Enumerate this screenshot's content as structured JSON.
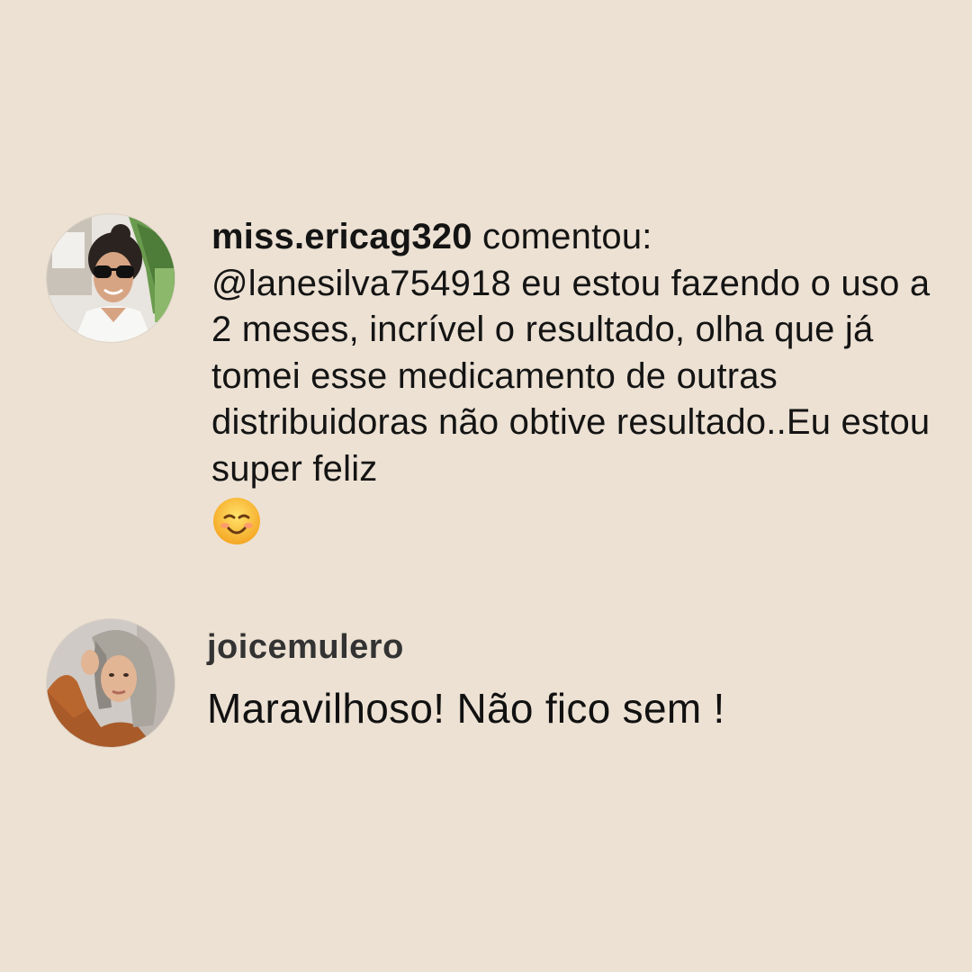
{
  "comments": [
    {
      "username": "miss.ericag320",
      "action": "comentou:",
      "text": "@lanesilva754918 eu estou fazendo o uso a 2 meses,  incrível o resultado, olha que já tomei esse medicamento de outras distribuidoras não obtive resultado..Eu estou super feliz",
      "emoji": "smiling-face-icon"
    },
    {
      "username": "joicemulero",
      "text": "Maravilhoso! Não fico sem !"
    }
  ],
  "colors": {
    "background": "#ece1d3",
    "text": "#141414",
    "username_secondary": "#333333"
  }
}
